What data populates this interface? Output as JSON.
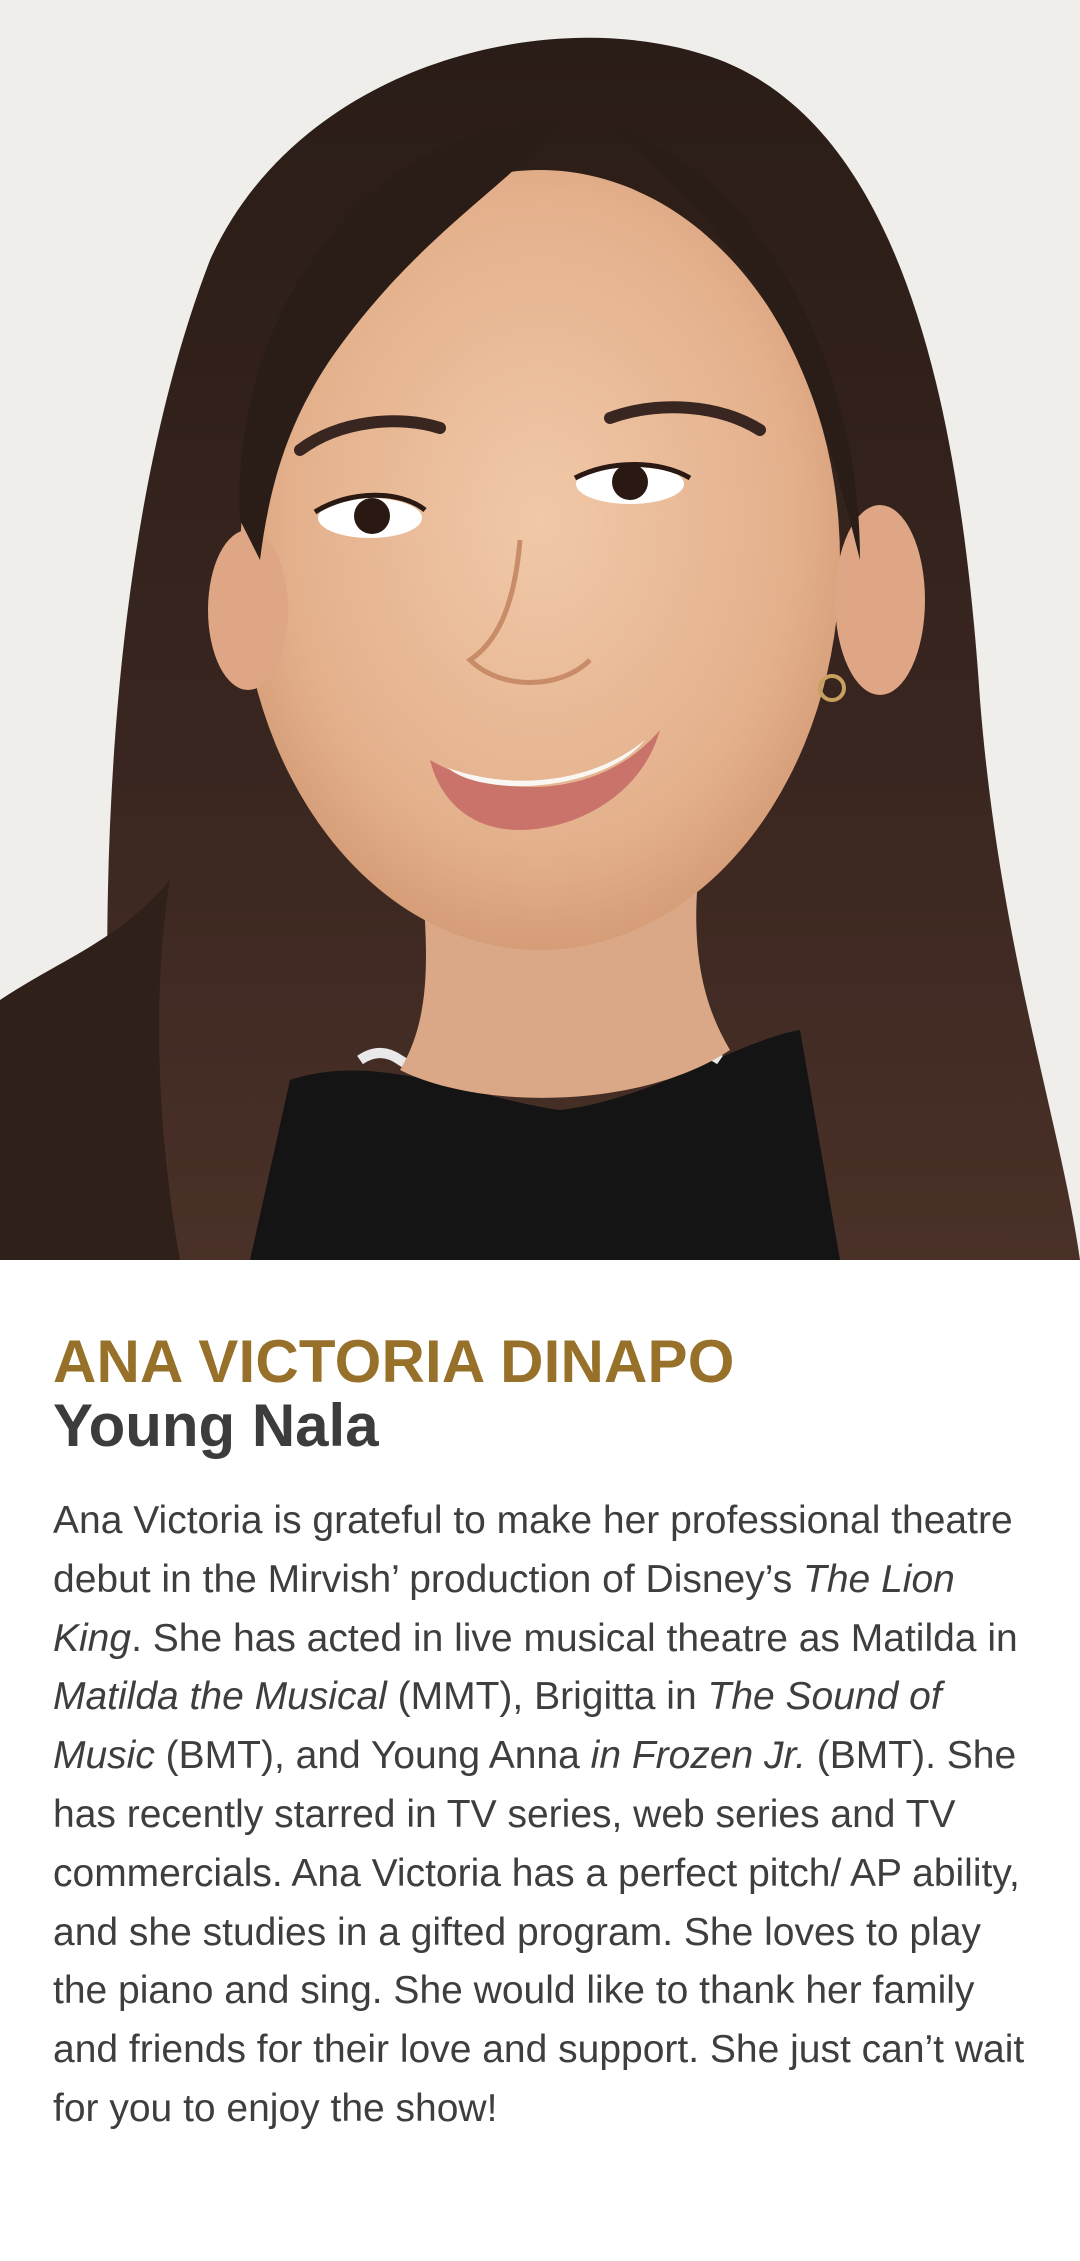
{
  "profile": {
    "name": "ANA VICTORIA DINAPO",
    "role": "Young Nala",
    "photo_subject": "headshot",
    "colors": {
      "name": "#97712a",
      "role": "#3c3c3c",
      "body": "#3e3e3e"
    }
  },
  "bio": {
    "s1": "Ana Victoria is grateful to make her professional theatre debut in the Mirvish’ production of Disney’s ",
    "s2": "The Lion King",
    "s3": ". She has acted in live musical theatre as Matilda in ",
    "s4": "Matilda the Musical",
    "s5": " (MMT), Brigitta in ",
    "s6": "The Sound of Music",
    "s7": " (BMT), and Young Anna ",
    "s8": "in Frozen Jr.",
    "s9": " (BMT). She has recently starred in TV series, web series and TV commercials. Ana Victoria has a perfect pitch/ AP ability, and she studies in a gifted program. She loves to play the piano and sing. She would like to thank her family and friends for their love and support. She just can’t wait for you to enjoy the show!"
  }
}
